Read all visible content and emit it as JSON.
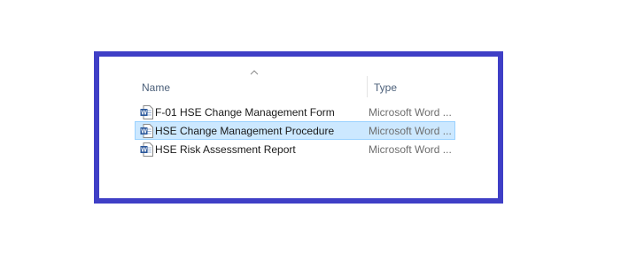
{
  "columns": {
    "name": "Name",
    "type": "Type",
    "sorted_by": "Name",
    "sort_icon": "sort-ascending-icon"
  },
  "files": [
    {
      "name": "F-01 HSE Change Management Form",
      "type": "Microsoft Word ...",
      "icon": "word-document-icon",
      "selected": false
    },
    {
      "name": "HSE Change Management Procedure",
      "type": "Microsoft Word ...",
      "icon": "word-document-icon",
      "selected": true
    },
    {
      "name": "HSE Risk Assessment Report",
      "type": "Microsoft Word ...",
      "icon": "word-document-icon",
      "selected": false
    }
  ],
  "colors": {
    "frame_border": "#3f3fc6",
    "selection_fill": "#cce8ff",
    "selection_border": "#99d1ff",
    "header_text": "#4c607a",
    "type_text": "#6d6d6d",
    "word_blue": "#2b579a"
  }
}
